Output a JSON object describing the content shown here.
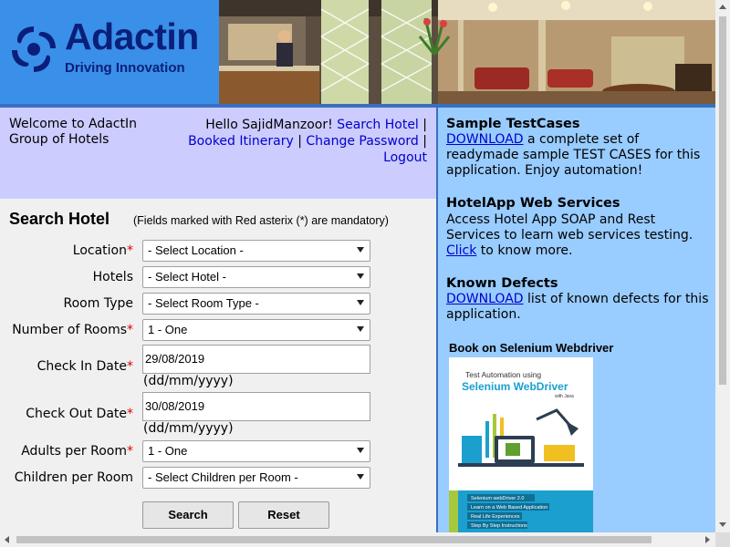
{
  "header": {
    "logo_name": "Adactin",
    "logo_tagline": "Driving Innovation"
  },
  "welcome": {
    "text": "Welcome to AdactIn Group of Hotels",
    "greeting": "Hello SajidManzoor!",
    "links": [
      "Search Hotel",
      "Booked Itinerary",
      "Change Password",
      "Logout"
    ]
  },
  "form": {
    "title": "Search Hotel",
    "note": "(Fields marked with Red asterix (*) are mandatory)",
    "fields": {
      "location": {
        "label": "Location",
        "value": "- Select Location -"
      },
      "hotels": {
        "label": "Hotels",
        "value": "- Select Hotel -"
      },
      "room_type": {
        "label": "Room Type",
        "value": "- Select Room Type -"
      },
      "rooms": {
        "label": "Number of Rooms",
        "value": "1 - One"
      },
      "check_in": {
        "label": "Check In Date",
        "value": "29/08/2019",
        "hint": "(dd/mm/yyyy)"
      },
      "check_out": {
        "label": "Check Out Date",
        "value": "30/08/2019",
        "hint": "(dd/mm/yyyy)"
      },
      "adults": {
        "label": "Adults per Room",
        "value": "1 - One"
      },
      "children": {
        "label": "Children per Room",
        "value": "- Select Children per Room -"
      }
    },
    "star": "*",
    "search_label": "Search",
    "reset_label": "Reset"
  },
  "sidebar": {
    "sections": [
      {
        "heading": "Sample TestCases",
        "link": "DOWNLOAD",
        "text": " a complete set of readymade sample TEST CASES for this application. Enjoy automation!"
      },
      {
        "heading": "HotelApp Web Services",
        "text_before": "Access Hotel App SOAP and Rest Services to learn web services testing. ",
        "link": "Click",
        "text": " to know more."
      },
      {
        "heading": "Known Defects",
        "link": "DOWNLOAD",
        "text": " list of known defects for this application."
      }
    ],
    "book_heading": "Book on Selenium Webdriver",
    "book_cover": {
      "line1": "Test Automation using",
      "line2": "Selenium WebDriver",
      "line3": "with Java",
      "bullets": [
        "Selenium webDriver 2.0",
        "Learn on a Web Based Application",
        "Real Life Experiences",
        "Step By Step Instructions"
      ]
    }
  },
  "colors": {
    "header_blue": "#3a8fe8",
    "brand_navy": "#0a1f7a",
    "welcome_bg": "#ccccff",
    "sidebar_bg": "#99ccff",
    "form_bg": "#f0f0f0",
    "link": "#0000cc",
    "mandatory": "#e00000"
  },
  "icons": [
    "adactin-logo-icon",
    "chevron-down-icon"
  ]
}
